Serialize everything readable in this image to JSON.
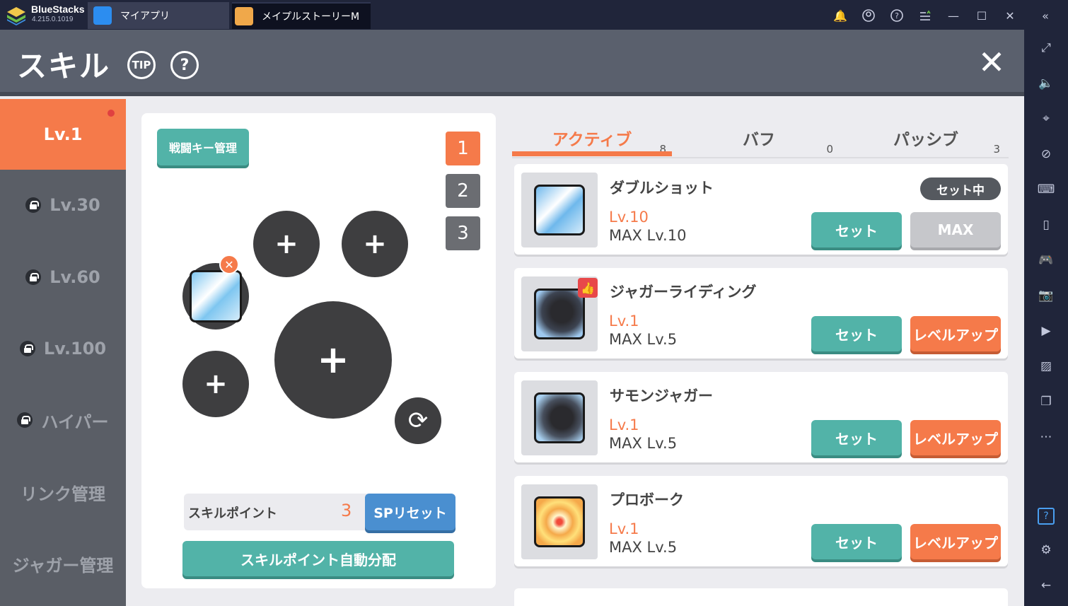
{
  "emulator": {
    "name": "BlueStacks",
    "version": "4.215.0.1019",
    "tabs": [
      {
        "label": "マイアプリ"
      },
      {
        "label": "メイプルストーリーM"
      }
    ]
  },
  "header": {
    "title": "スキル",
    "tip_label": "TIP",
    "help_label": "?",
    "close_label": "✕"
  },
  "nav": {
    "items": [
      {
        "label": "Lv.1"
      },
      {
        "label": "Lv.30"
      },
      {
        "label": "Lv.60"
      },
      {
        "label": "Lv.100"
      },
      {
        "label": "ハイパー"
      },
      {
        "label": "リンク管理"
      },
      {
        "label": "ジャガー管理"
      }
    ]
  },
  "slots": {
    "battle_key_label": "戦闘キー管理",
    "set_numbers": [
      "1",
      "2",
      "3"
    ],
    "plus": "+"
  },
  "skill_points": {
    "label": "スキルポイント",
    "value": "3",
    "reset_label": "SPリセット",
    "auto_assign_label": "スキルポイント自動分配"
  },
  "tabs": [
    {
      "label": "アクティブ",
      "count": "8"
    },
    {
      "label": "バフ",
      "count": "0"
    },
    {
      "label": "パッシブ",
      "count": "3"
    }
  ],
  "skills": [
    {
      "name": "ダブルショット",
      "level": "Lv.10",
      "max": "MAX Lv.10",
      "badge": "セット中",
      "set_label": "セット",
      "right_label": "MAX"
    },
    {
      "name": "ジャガーライディング",
      "level": "Lv.1",
      "max": "MAX Lv.5",
      "set_label": "セット",
      "right_label": "レベルアップ"
    },
    {
      "name": "サモンジャガー",
      "level": "Lv.1",
      "max": "MAX Lv.5",
      "set_label": "セット",
      "right_label": "レベルアップ"
    },
    {
      "name": "プロボーク",
      "level": "Lv.1",
      "max": "MAX Lv.5",
      "set_label": "セット",
      "right_label": "レベルアップ"
    }
  ],
  "colors": {
    "accent": "#f57a4a",
    "teal": "#52b3a8",
    "blue": "#4a8fd0",
    "header": "#5a606d",
    "chrome": "#20253a"
  }
}
